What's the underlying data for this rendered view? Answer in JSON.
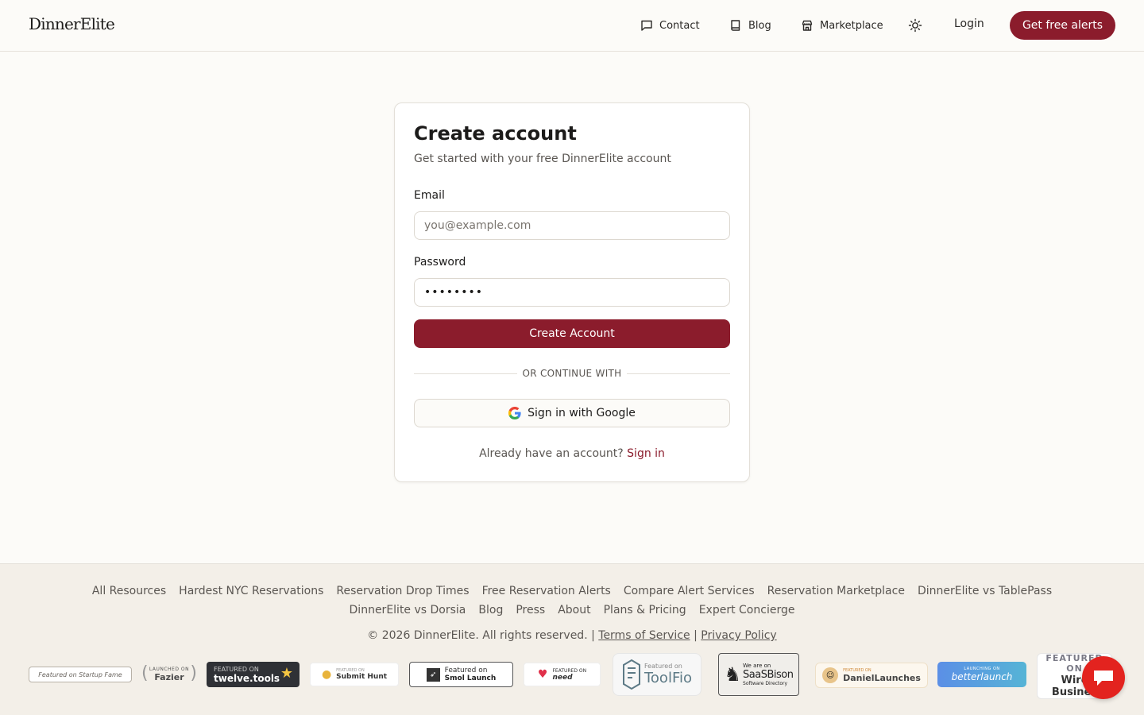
{
  "header": {
    "logo": "DinnerElite",
    "nav": {
      "contact": "Contact",
      "blog": "Blog",
      "marketplace": "Marketplace"
    },
    "login": "Login",
    "cta": "Get free alerts"
  },
  "card": {
    "title": "Create account",
    "subtitle": "Get started with your free DinnerElite account",
    "email_label": "Email",
    "email_placeholder": "you@example.com",
    "password_label": "Password",
    "password_value": "••••••••",
    "submit": "Create Account",
    "divider": "OR CONTINUE WITH",
    "google": "Sign in with Google",
    "have_account": "Already have an account?",
    "signin": "Sign in"
  },
  "footer": {
    "links_row1": [
      "All Resources",
      "Hardest NYC Reservations",
      "Reservation Drop Times",
      "Free Reservation Alerts",
      "Compare Alert Services",
      "Reservation Marketplace",
      "DinnerElite vs TablePass"
    ],
    "links_row2": [
      "DinnerElite vs Dorsia",
      "Blog",
      "Press",
      "About",
      "Plans & Pricing",
      "Expert Concierge"
    ],
    "copyright": "© 2026 DinnerElite. All rights reserved. |",
    "terms": "Terms of Service",
    "sep": "|",
    "privacy": "Privacy Policy",
    "badges": {
      "startup_fame": "Featured on Startup Fame",
      "fazier_top": "LAUNCHED ON",
      "fazier": "Fazier",
      "twelve_top": "FEATURED ON",
      "twelve": "twelve.tools",
      "submit_top": "FEATURED ON",
      "submit": "Submit Hunt",
      "smol_top": "Featured on",
      "smol": "Smol Launch",
      "need_top": "FEATURED ON",
      "need": "need",
      "toolfio_top": "Featured on",
      "toolfio": "ToolFio",
      "saasbison_top": "We are on",
      "saasbison": "SaaSBison",
      "saasbison_sub": "Software Directory",
      "daniel_top": "FEATURED ON",
      "daniel": "DanielLaunches",
      "better_top": "LAUNCHING ON",
      "better": "betterlaunch",
      "wired_top": "FEATURED",
      "wired_on": "ON",
      "wired_1": "Wire",
      "wired_2": "Busines"
    }
  },
  "colors": {
    "brand": "#8b1c2c",
    "background": "#fcfbf8",
    "footer_bg": "#f3efe8",
    "chat": "#e3231f"
  }
}
